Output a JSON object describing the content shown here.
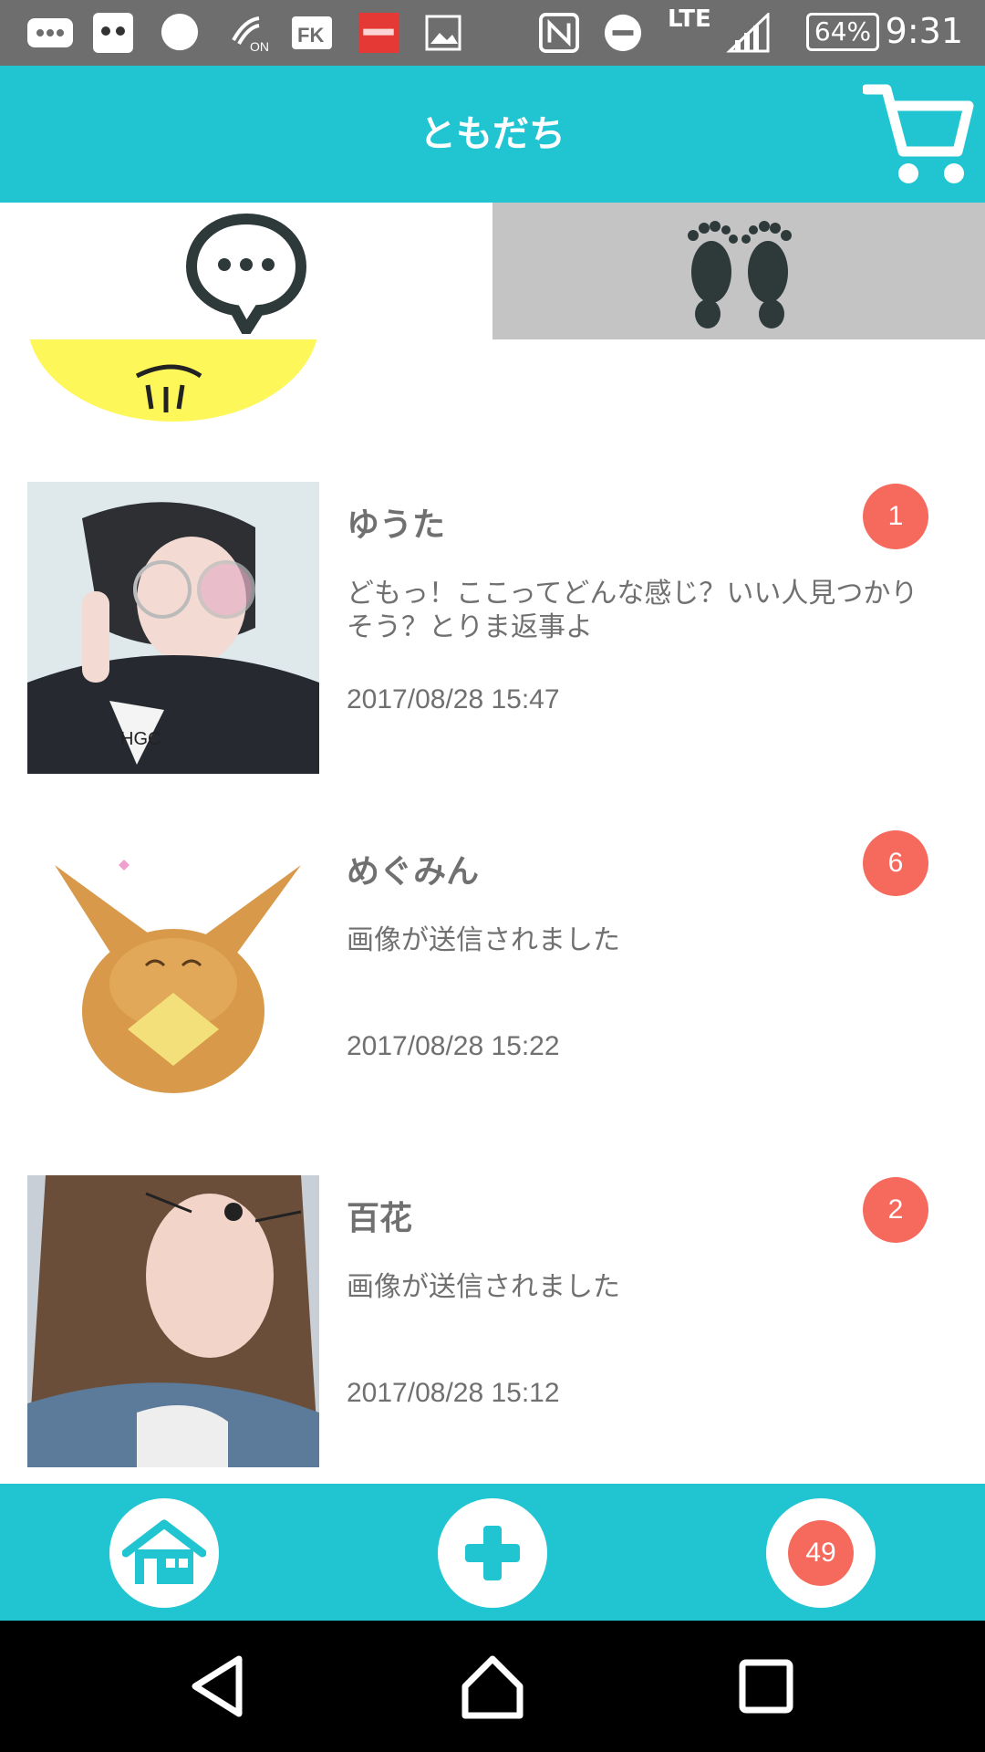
{
  "status_bar": {
    "network": "LTE",
    "battery": "64%",
    "time": "9:31"
  },
  "header": {
    "title": "ともだち"
  },
  "tabs": [
    {
      "icon": "chat-bubble-icon",
      "active": true
    },
    {
      "icon": "footprints-icon",
      "active": false
    }
  ],
  "conversations": [
    {
      "name": "ゆうた",
      "message": "どもっ！ここってどんな感じ？いい人見つかりそう？とりま返事よ",
      "time": "2017/08/28 15:47",
      "unread": "1"
    },
    {
      "name": "めぐみん",
      "message": "画像が送信されました",
      "time": "2017/08/28 15:22",
      "unread": "6"
    },
    {
      "name": "百花",
      "message": "画像が送信されました",
      "time": "2017/08/28 15:12",
      "unread": "2"
    }
  ],
  "bottom_bar": {
    "home_icon": "home-icon",
    "add_icon": "plus-icon",
    "notifications_count": "49"
  },
  "colors": {
    "accent": "#21c5d2",
    "badge": "#f66a5e",
    "text": "#707070"
  }
}
